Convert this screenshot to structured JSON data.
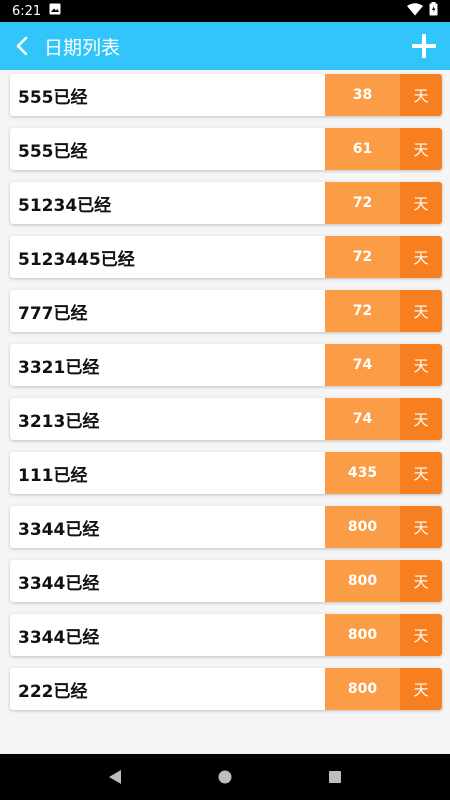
{
  "status_bar": {
    "time": "6:21"
  },
  "app_bar": {
    "title": "日期列表"
  },
  "items": [
    {
      "label": "555已经",
      "days": "38",
      "unit": "天"
    },
    {
      "label": "555已经",
      "days": "61",
      "unit": "天"
    },
    {
      "label": "51234已经",
      "days": "72",
      "unit": "天"
    },
    {
      "label": "5123445已经",
      "days": "72",
      "unit": "天"
    },
    {
      "label": "777已经",
      "days": "72",
      "unit": "天"
    },
    {
      "label": "3321已经",
      "days": "74",
      "unit": "天"
    },
    {
      "label": "3213已经",
      "days": "74",
      "unit": "天"
    },
    {
      "label": "111已经",
      "days": "435",
      "unit": "天"
    },
    {
      "label": "3344已经",
      "days": "800",
      "unit": "天"
    },
    {
      "label": "3344已经",
      "days": "800",
      "unit": "天"
    },
    {
      "label": "3344已经",
      "days": "800",
      "unit": "天"
    },
    {
      "label": "222已经",
      "days": "800",
      "unit": "天"
    }
  ],
  "colors": {
    "app_bar": "#32c5fa",
    "count_bg": "#fb9d46",
    "unit_bg": "#f77f20"
  },
  "icons": [
    "back-icon",
    "add-icon",
    "wifi-icon",
    "battery-icon",
    "image-icon",
    "nav-back-icon",
    "nav-home-icon",
    "nav-recents-icon"
  ]
}
